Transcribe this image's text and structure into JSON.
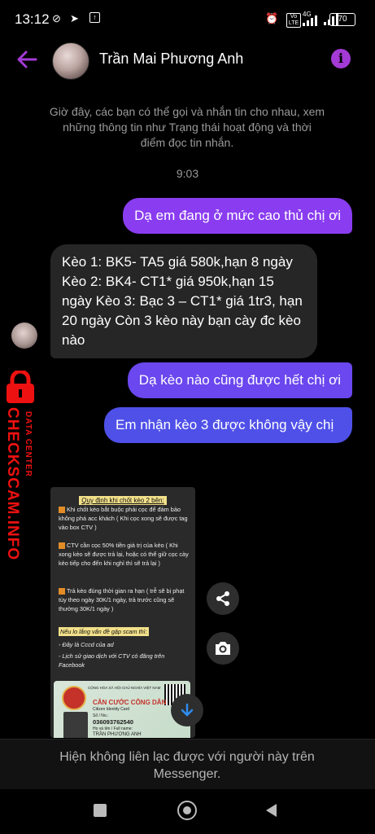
{
  "status_bar": {
    "time": "13:12",
    "network_label": "4G",
    "volte_label": "Vo LTE",
    "battery": "70"
  },
  "header": {
    "contact_name": "Trần Mai Phương Anh",
    "accent_color": "#a33ad6"
  },
  "conversation": {
    "system_notice": "Giờ đây, các bạn có thể gọi và nhắn tin cho nhau, xem những thông tin như Trạng thái hoạt động và thời điểm đọc tin nhắn.",
    "timestamp": "9:03",
    "messages": [
      {
        "direction": "outgoing",
        "text": "Dạ em đang ở mức cao thủ chị ơi"
      },
      {
        "direction": "incoming",
        "text": "Kèo 1: BK5- TA5 giá 580k,hạn 8 ngày Kèo 2: BK4- CT1* giá 950k,hạn 15 ngày Kèo 3: Bạc 3 – CT1* giá 1tr3, hạn 20 ngày Còn 3 kèo này bạn cày đc kèo nào"
      },
      {
        "direction": "outgoing",
        "text": "Dạ kèo nào cũng được hết chị ơi"
      },
      {
        "direction": "outgoing",
        "text": "Em nhận kèo 3 được không vậy chị"
      }
    ]
  },
  "watermark": {
    "small_text": "DATA CENTER",
    "big_text": "CHECKSCAM.INFO"
  },
  "shared_image": {
    "heading": "Quy định khi chốt kèo 2 bên:",
    "rules": [
      "Khi chốt kèo bắt buộc phải cọc để đảm bảo không phá acc khách ( Khi cọc xong sẽ được tag vào box CTV )",
      "CTV cần cọc 50% tiền giá trị của kèo ( Khi xong kèo sẽ được trả lại, hoặc có thể giữ cọc cày kèo tiếp cho đến khi nghỉ thì sẽ trả lại )",
      "Trả kèo đúng thời gian ra hạn ( trễ sẽ bị phạt tùy theo ngày 30K/1 ngày, trả trước cũng sẽ thưởng 30K/1 ngày )"
    ],
    "note_title": "Nếu lo lắng vấn đề gặp scam thì:",
    "notes": [
      "- Đây là Cccd của ad",
      "- Lịch sử giao dịch với CTV có đăng trên Facebook"
    ],
    "id_card": {
      "header": "CỘNG HÒA XÃ HỘI CHỦ NGHĨA VIỆT NAM",
      "title": "CĂN CƯỚC CÔNG DÂN",
      "subtitle": "Citizen Identity Card",
      "number_label": "Số / No.:",
      "number": "036093762540",
      "name_label": "Họ và tên / Full name:",
      "name": "TRẦN PHƯƠNG ANH"
    }
  },
  "footer": {
    "notice": "Hiện không liên lạc được với người này trên Messenger."
  }
}
